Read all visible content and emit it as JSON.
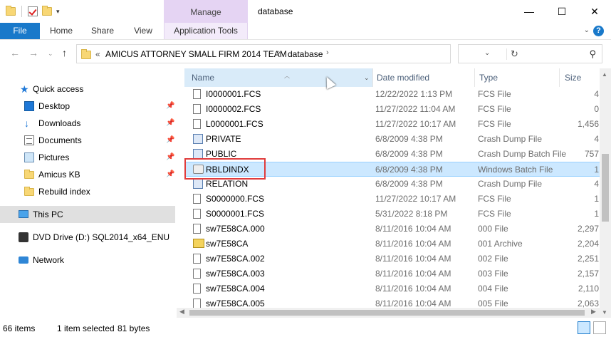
{
  "window": {
    "title": "database",
    "contextual_tab_group": "Manage",
    "controls": {
      "minimize": "—",
      "maximize": "☐",
      "close": "✕"
    }
  },
  "ribbon": {
    "tabs": [
      {
        "label": "File"
      },
      {
        "label": "Home"
      },
      {
        "label": "Share"
      },
      {
        "label": "View"
      },
      {
        "label": "Application Tools"
      }
    ]
  },
  "address": {
    "overflow": "«",
    "crumbs": [
      "AMICUS ATTORNEY SMALL FIRM 2014 TEAM",
      "database"
    ],
    "search_placeholder": ""
  },
  "nav_pane": {
    "items": [
      {
        "label": "Quick access",
        "icon": "star-icon"
      },
      {
        "label": "Desktop",
        "icon": "desktop-icon",
        "pinned": true
      },
      {
        "label": "Downloads",
        "icon": "download-icon",
        "pinned": true
      },
      {
        "label": "Documents",
        "icon": "documents-icon",
        "pinned": true
      },
      {
        "label": "Pictures",
        "icon": "pictures-icon",
        "pinned": true
      },
      {
        "label": "Amicus KB",
        "icon": "folder-icon",
        "pinned": true
      },
      {
        "label": "Rebuild index",
        "icon": "folder-icon"
      },
      {
        "label": "This PC",
        "icon": "pc-icon",
        "selected": true
      },
      {
        "label": "DVD Drive (D:) SQL2014_x64_ENU",
        "icon": "dvd-icon"
      },
      {
        "label": "Network",
        "icon": "network-icon"
      }
    ]
  },
  "columns": {
    "name": "Name",
    "date": "Date modified",
    "type": "Type",
    "size": "Size"
  },
  "files": [
    {
      "name": "I0000001.FCS",
      "date": "12/22/2022 1:13 PM",
      "type": "FCS File",
      "size": "4",
      "icon": "file-icon"
    },
    {
      "name": "I0000002.FCS",
      "date": "11/27/2022 11:04 AM",
      "type": "FCS File",
      "size": "0",
      "icon": "file-icon"
    },
    {
      "name": "L0000001.FCS",
      "date": "11/27/2022 10:17 AM",
      "type": "FCS File",
      "size": "1,456",
      "icon": "file-icon"
    },
    {
      "name": "PRIVATE",
      "date": "6/8/2009 4:38 PM",
      "type": "Crash Dump File",
      "size": "4",
      "icon": "crash-dump-icon"
    },
    {
      "name": "PUBLIC",
      "date": "6/8/2009 4:38 PM",
      "type": "Crash Dump Batch File",
      "size": "757",
      "icon": "crash-dump-icon"
    },
    {
      "name": "RBLDINDX",
      "date": "6/8/2009 4:38 PM",
      "type": "Windows Batch File",
      "size": "1",
      "icon": "batch-file-icon",
      "selected": true
    },
    {
      "name": "RELATION",
      "date": "6/8/2009 4:38 PM",
      "type": "Crash Dump File",
      "size": "4",
      "icon": "crash-dump-icon"
    },
    {
      "name": "S0000000.FCS",
      "date": "11/27/2022 10:17 AM",
      "type": "FCS File",
      "size": "1",
      "icon": "file-icon"
    },
    {
      "name": "S0000001.FCS",
      "date": "5/31/2022 8:18 PM",
      "type": "FCS File",
      "size": "1",
      "icon": "file-icon"
    },
    {
      "name": "sw7E58CA.000",
      "date": "8/11/2016 10:04 AM",
      "type": "000 File",
      "size": "2,297",
      "icon": "file-icon"
    },
    {
      "name": "sw7E58CA",
      "date": "8/11/2016 10:04 AM",
      "type": "001 Archive",
      "size": "2,204",
      "icon": "archive-icon"
    },
    {
      "name": "sw7E58CA.002",
      "date": "8/11/2016 10:04 AM",
      "type": "002 File",
      "size": "2,251",
      "icon": "file-icon"
    },
    {
      "name": "sw7E58CA.003",
      "date": "8/11/2016 10:04 AM",
      "type": "003 File",
      "size": "2,157",
      "icon": "file-icon"
    },
    {
      "name": "sw7E58CA.004",
      "date": "8/11/2016 10:04 AM",
      "type": "004 File",
      "size": "2,110",
      "icon": "file-icon"
    },
    {
      "name": "sw7E58CA.005",
      "date": "8/11/2016 10:04 AM",
      "type": "005 File",
      "size": "2,063",
      "icon": "file-icon"
    }
  ],
  "status": {
    "item_count": "66 items",
    "selection": "1 item selected",
    "selection_size": "81 bytes"
  },
  "colors": {
    "file_tab": "#1979ca",
    "manage_tab": "#e5d4f3",
    "selected_row": "#cce8ff",
    "highlight_box": "#e03c3c"
  }
}
